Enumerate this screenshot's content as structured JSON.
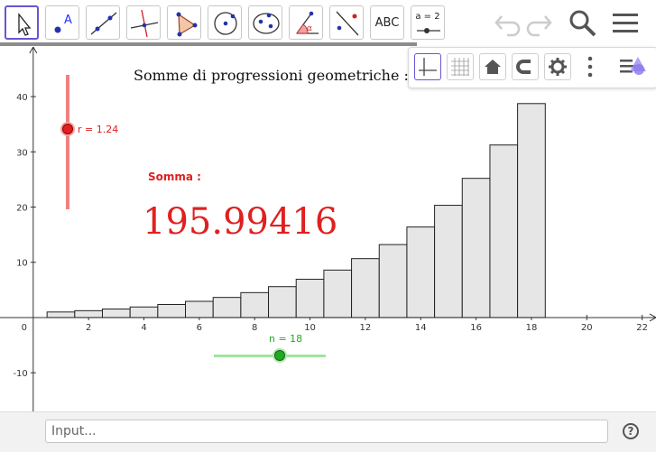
{
  "toolbar": {
    "tools": [
      {
        "name": "move-tool",
        "icon": "arrow-cursor-icon"
      },
      {
        "name": "point-tool",
        "icon": "point-icon",
        "label": "A"
      },
      {
        "name": "line-tool",
        "icon": "line-icon"
      },
      {
        "name": "perpendicular-tool",
        "icon": "perpendicular-line-icon"
      },
      {
        "name": "polygon-tool",
        "icon": "polygon-icon"
      },
      {
        "name": "circle-tool",
        "icon": "circle-center-icon"
      },
      {
        "name": "ellipse-tool",
        "icon": "ellipse-icon"
      },
      {
        "name": "angle-tool",
        "icon": "angle-icon",
        "label": "α"
      },
      {
        "name": "reflect-tool",
        "icon": "reflect-icon"
      },
      {
        "name": "text-tool",
        "icon": "text-icon",
        "label": "ABC"
      },
      {
        "name": "slider-tool",
        "icon": "slider-icon",
        "label": "a = 2"
      }
    ],
    "right": [
      "undo-icon",
      "redo-icon",
      "search-icon",
      "menu-icon"
    ]
  },
  "view_panel": [
    "axes-icon",
    "grid-icon",
    "home-icon",
    "magnet-icon",
    "gear-icon",
    "more-icon",
    "style-bar-icon"
  ],
  "graphics": {
    "title": "Somme di progressioni geometriche :",
    "somma_label": "Somma :",
    "somma_value": "195.99416",
    "slider_r": {
      "label": "r = 1.24",
      "value": 1.24
    },
    "slider_n": {
      "label": "n = 18",
      "value": 18
    },
    "colors": {
      "r": "#e02020",
      "n": "#22aa22",
      "bar_fill": "#e6e6e6",
      "bar_stroke": "#222"
    }
  },
  "chart_data": {
    "type": "bar",
    "x_ticks": [
      0,
      2,
      4,
      6,
      8,
      10,
      12,
      14,
      16,
      18,
      20,
      22
    ],
    "y_ticks": [
      -10,
      10,
      20,
      30,
      40
    ],
    "xlim": [
      -1.2,
      22.5
    ],
    "ylim": [
      -17,
      49
    ],
    "x": [
      1,
      2,
      3,
      4,
      5,
      6,
      7,
      8,
      9,
      10,
      11,
      12,
      13,
      14,
      15,
      16,
      17,
      18
    ],
    "values": [
      1,
      1.24,
      1.54,
      1.91,
      2.36,
      2.93,
      3.64,
      4.51,
      5.59,
      6.93,
      8.59,
      10.66,
      13.21,
      16.39,
      20.32,
      25.2,
      31.24,
      38.74
    ]
  },
  "input": {
    "placeholder": "Input..."
  },
  "help_label": "?"
}
